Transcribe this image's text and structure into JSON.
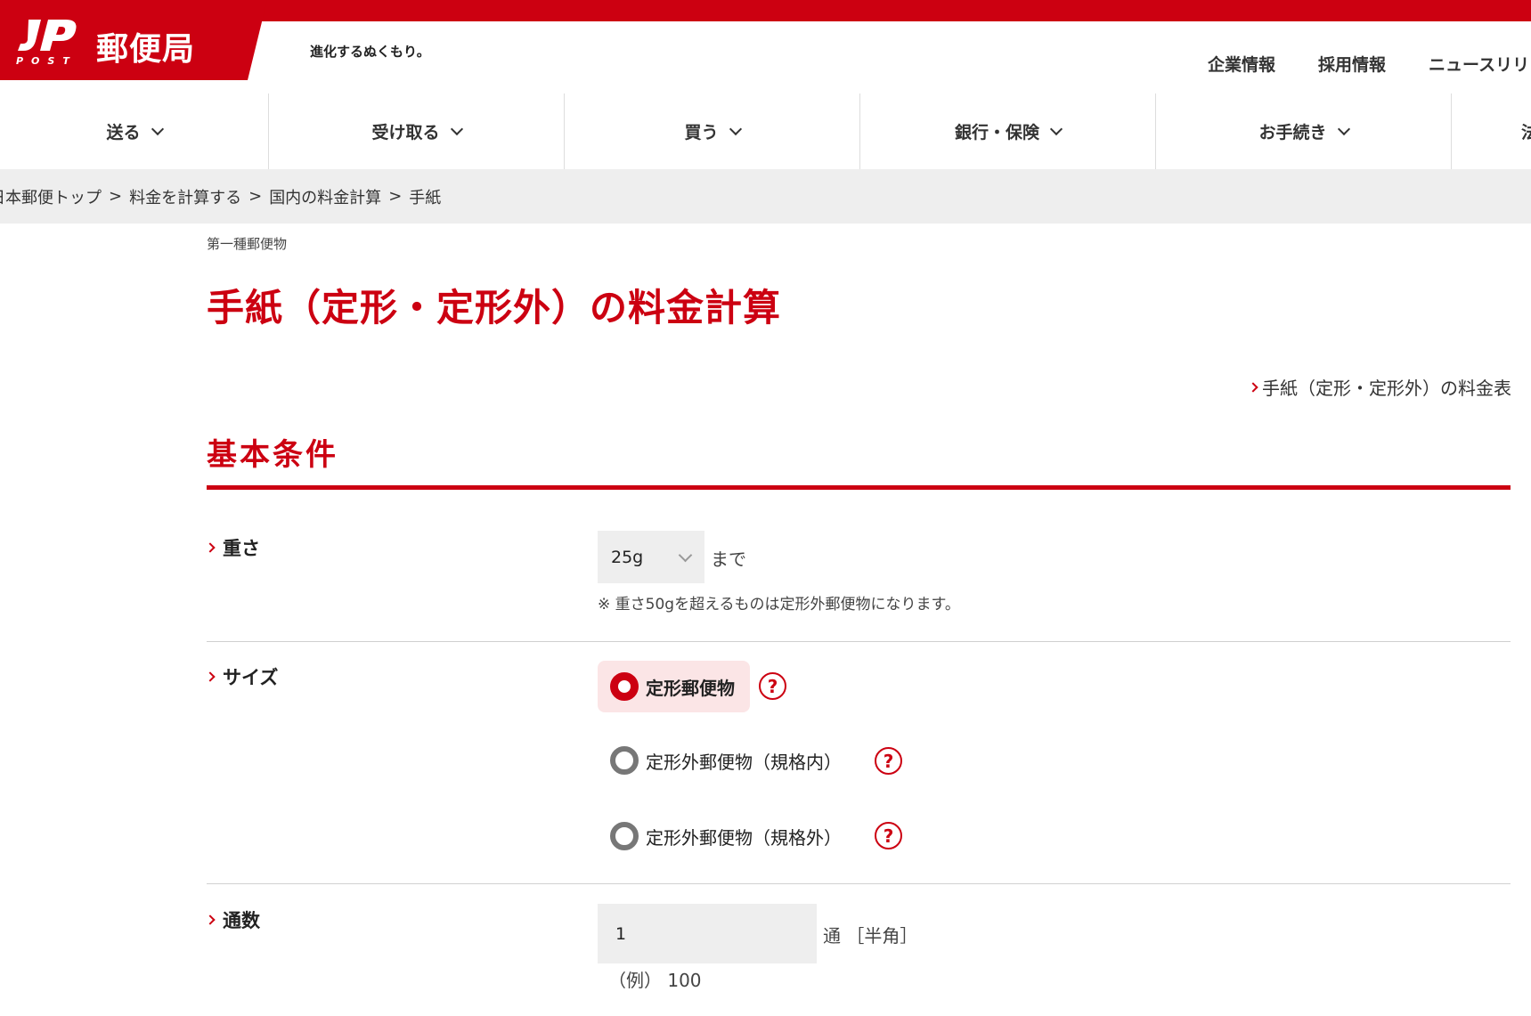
{
  "header": {
    "logo_text": "JP",
    "logo_sub": "POST",
    "brand_name": "郵便局",
    "tagline": "進化するぬくもり。",
    "utility_links": [
      "企業情報",
      "採用情報",
      "ニュースリリ"
    ]
  },
  "gnav": {
    "items": [
      "送る",
      "受け取る",
      "買う",
      "銀行・保険",
      "お手続き",
      "法"
    ]
  },
  "breadcrumb": {
    "items": [
      "日本郵便トップ",
      "料金を計算する",
      "国内の料金計算",
      "手紙"
    ],
    "separator": ">"
  },
  "page": {
    "eyebrow": "第一種郵便物",
    "title": "手紙（定形・定形外）の料金計算",
    "rate_table_link": "手紙（定形・定形外）の料金表"
  },
  "section": {
    "title": "基本条件"
  },
  "weight": {
    "label": "重さ",
    "selected_value": "25g",
    "suffix": "まで",
    "note": "※ 重さ50gを超えるものは定形外郵便物になります。"
  },
  "size": {
    "label": "サイズ",
    "options": [
      {
        "label": "定形郵便物",
        "selected": true
      },
      {
        "label": "定形外郵便物（規格内）",
        "selected": false
      },
      {
        "label": "定形外郵便物（規格外）",
        "selected": false
      }
    ],
    "help_glyph": "?"
  },
  "count": {
    "label": "通数",
    "value": "1",
    "unit": "通 ［半角］",
    "example": "（例） 100"
  },
  "colors": {
    "brand_red": "#cc0011",
    "gray_bg": "#eeeeee",
    "selected_bg": "#fbe5e6"
  }
}
